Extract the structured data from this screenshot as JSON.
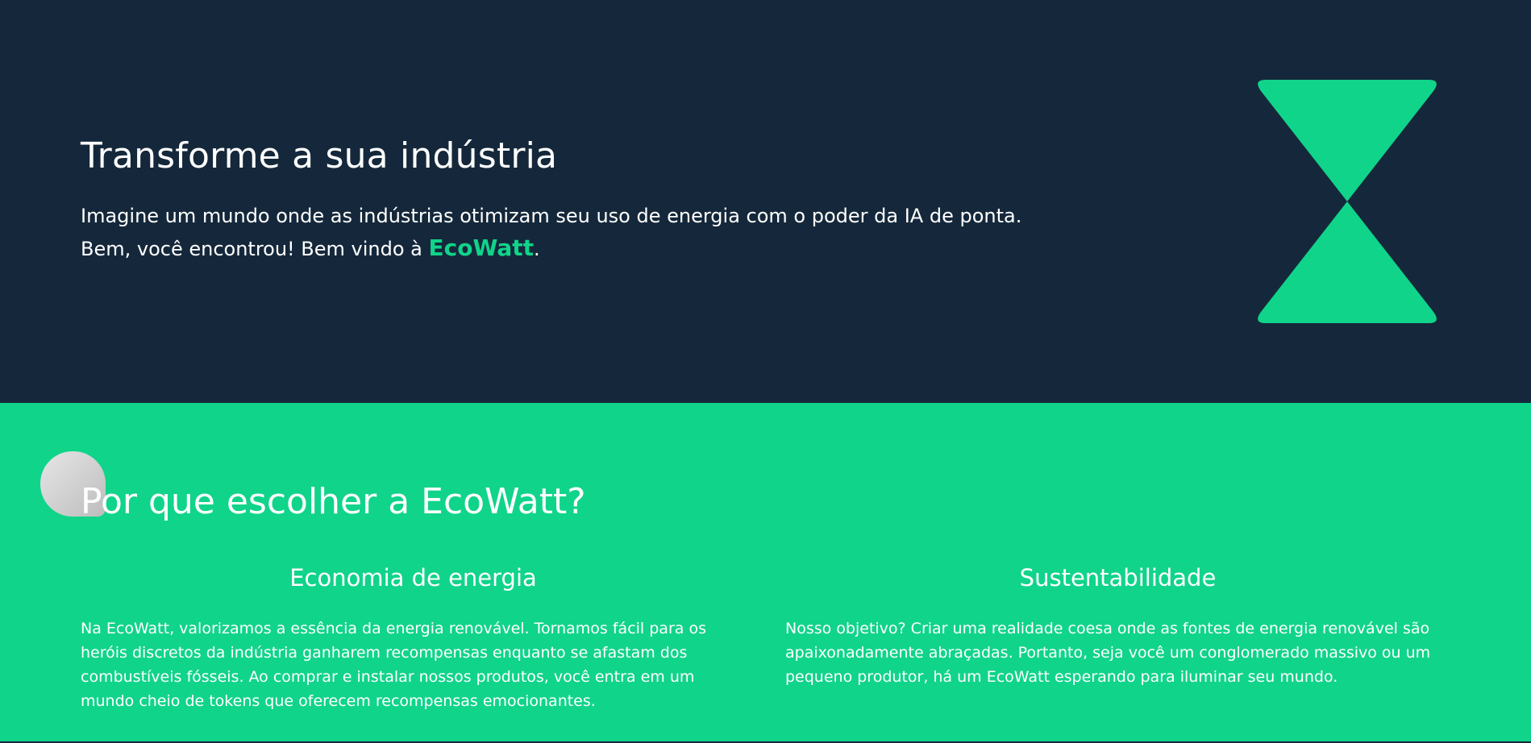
{
  "hero": {
    "title": "Transforme a sua indústria",
    "line1": "Imagine um mundo onde as indústrias otimizam seu uso de energia com o poder da IA de ponta.",
    "line2_prefix": "Bem, você encontrou! Bem vindo à ",
    "brand": "EcoWatt",
    "line2_suffix": ".",
    "logo_icon": "hourglass-logo-icon"
  },
  "features": {
    "title": "Por que escolher a EcoWatt?",
    "items": [
      {
        "title": "Economia de energia",
        "text": "Na EcoWatt, valorizamos a essência da energia renovável. Tornamos fácil para os heróis discretos da indústria ganharem recompensas enquanto se afastam dos combustíveis fósseis. Ao comprar e instalar nossos produtos, você entra em um mundo cheio de tokens que oferecem recompensas emocionantes."
      },
      {
        "title": "Sustentabilidade",
        "text": "Nosso objetivo? Criar uma realidade coesa onde as fontes de energia renovável são apaixonadamente abraçadas. Portanto, seja você um conglomerado massivo ou um pequeno produtor, há um EcoWatt esperando para iluminar seu mundo."
      }
    ]
  },
  "colors": {
    "dark": "#15283b",
    "accent": "#10d48a",
    "text": "#ffffff"
  }
}
